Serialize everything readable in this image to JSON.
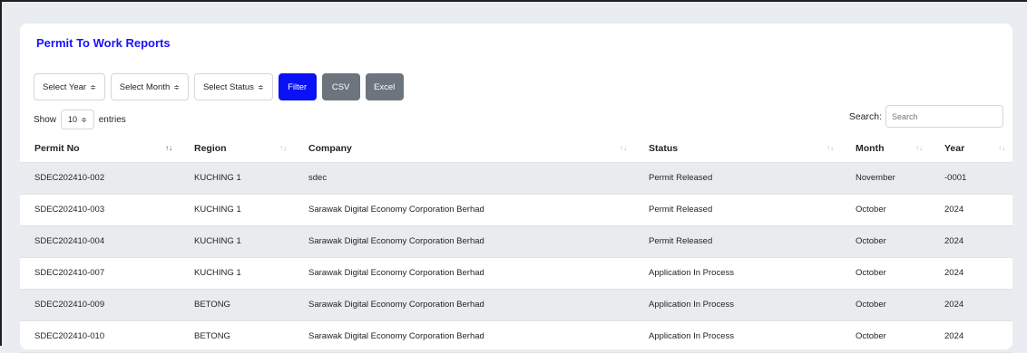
{
  "page": {
    "title": "Permit To Work Reports"
  },
  "filters": {
    "year": "Select Year",
    "month": "Select Month",
    "status": "Select Status",
    "sort_arrow": "≑"
  },
  "buttons": {
    "filter": "Filter",
    "csv": "CSV",
    "excel": "Excel"
  },
  "length": {
    "show": "Show",
    "value": "10",
    "entries": "entries"
  },
  "search": {
    "label": "Search:",
    "placeholder": "Search"
  },
  "table": {
    "headers": [
      "Permit No",
      "Region",
      "Company",
      "Status",
      "Month",
      "Year"
    ],
    "rows": [
      [
        "SDEC202410-002",
        "KUCHING 1",
        "sdec",
        "Permit Released",
        "November",
        "-0001"
      ],
      [
        "SDEC202410-003",
        "KUCHING 1",
        "Sarawak Digital Economy Corporation Berhad",
        "Permit Released",
        "October",
        "2024"
      ],
      [
        "SDEC202410-004",
        "KUCHING 1",
        "Sarawak Digital Economy Corporation Berhad",
        "Permit Released",
        "October",
        "2024"
      ],
      [
        "SDEC202410-007",
        "KUCHING 1",
        "Sarawak Digital Economy Corporation Berhad",
        "Application In Process",
        "October",
        "2024"
      ],
      [
        "SDEC202410-009",
        "BETONG",
        "Sarawak Digital Economy Corporation Berhad",
        "Application In Process",
        "October",
        "2024"
      ],
      [
        "SDEC202410-010",
        "BETONG",
        "Sarawak Digital Economy Corporation Berhad",
        "Application In Process",
        "October",
        "2024"
      ]
    ]
  },
  "colors": {
    "accent": "#0a12f5",
    "title": "#1a12ff",
    "secondary": "#6c757d",
    "stripe": "#e9ecef"
  }
}
